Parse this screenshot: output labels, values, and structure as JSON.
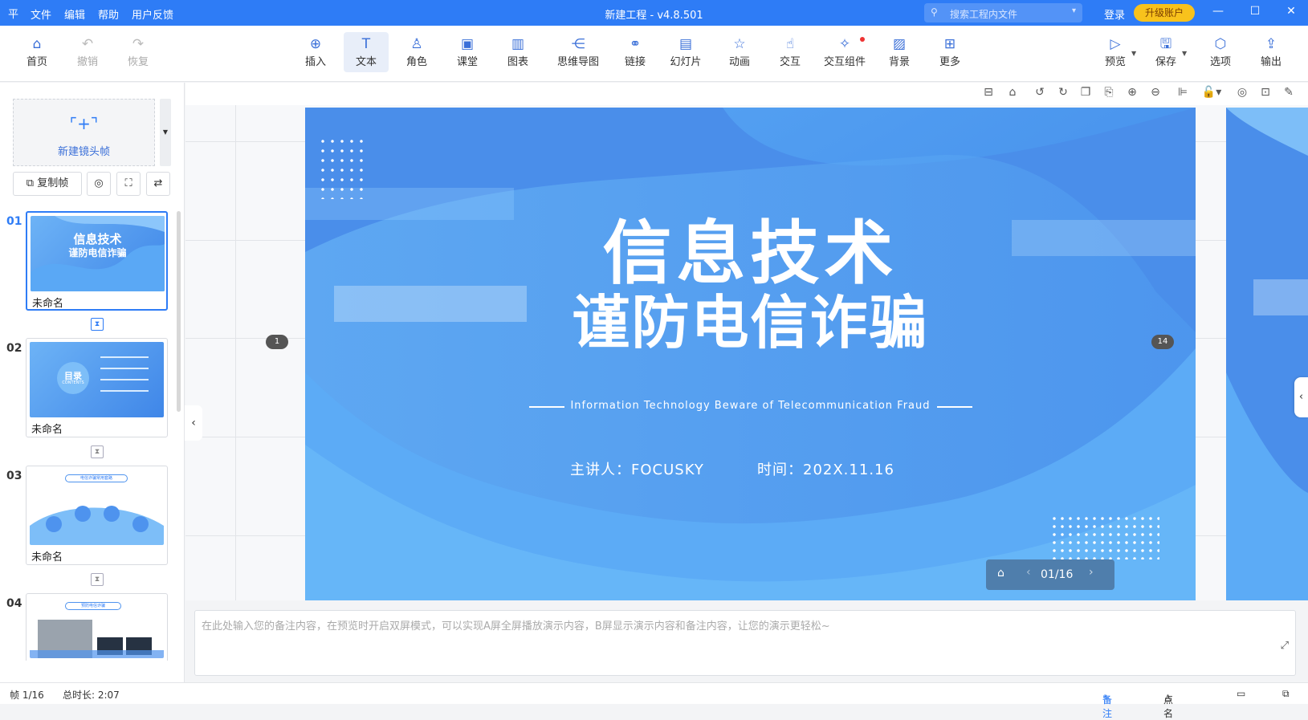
{
  "app": {
    "title": "新建工程 - v4.8.501",
    "logo_glyph": "平",
    "menu": [
      "文件",
      "编辑",
      "帮助",
      "用户反馈"
    ],
    "search_placeholder": "搜索工程内文件",
    "login": "登录",
    "upgrade": "升级账户"
  },
  "toolbar": {
    "left": [
      {
        "label": "首页",
        "icon": "home-icon"
      },
      {
        "label": "撤销",
        "icon": "undo-icon"
      },
      {
        "label": "恢复",
        "icon": "redo-icon"
      }
    ],
    "center": [
      {
        "label": "插入",
        "icon": "plus-circle-icon"
      },
      {
        "label": "文本",
        "icon": "text-icon"
      },
      {
        "label": "角色",
        "icon": "character-icon"
      },
      {
        "label": "课堂",
        "icon": "classroom-icon"
      },
      {
        "label": "图表",
        "icon": "chart-icon"
      },
      {
        "label": "思维导图",
        "icon": "mindmap-icon"
      },
      {
        "label": "链接",
        "icon": "link-icon"
      },
      {
        "label": "幻灯片",
        "icon": "slides-icon"
      },
      {
        "label": "动画",
        "icon": "star-icon"
      },
      {
        "label": "交互",
        "icon": "pointer-icon"
      },
      {
        "label": "交互组件",
        "icon": "interactive-component-icon"
      },
      {
        "label": "背景",
        "icon": "background-icon"
      },
      {
        "label": "更多",
        "icon": "more-grid-icon"
      }
    ],
    "right": [
      {
        "label": "预览",
        "icon": "preview-icon"
      },
      {
        "label": "保存",
        "icon": "save-icon"
      },
      {
        "label": "选项",
        "icon": "options-icon"
      },
      {
        "label": "输出",
        "icon": "export-icon"
      }
    ]
  },
  "left_panel": {
    "new_frame": "新建镜头帧",
    "copy_frame": "复制帧",
    "frames": [
      {
        "num": "01",
        "caption": "未命名",
        "thumb_title1": "信息技术",
        "thumb_title2": "谨防电信诈骗"
      },
      {
        "num": "02",
        "caption": "未命名",
        "thumb_title1": "目录",
        "thumb_title2": "CONTENTS"
      },
      {
        "num": "03",
        "caption": "未命名",
        "thumb_title1": "电信诈骗常用套路"
      },
      {
        "num": "04",
        "caption": "",
        "thumb_title1": "预防电信诈骗"
      }
    ]
  },
  "slide": {
    "title_line1": "信息技术",
    "title_line2": "谨防电信诈骗",
    "subtitle": "Information Technology Beware of Telecommunication Fraud",
    "presenter": "主讲人：FOCUSKY",
    "time": "时间：202X.11.16",
    "badge_left": "1",
    "badge_right": "14"
  },
  "pager": {
    "text": "01/16"
  },
  "notes": {
    "placeholder": "在此处输入您的备注内容，在预览时开启双屏模式，可以实现A屏全屏播放演示内容，B屏显示演示内容和备注内容，让您的演示更轻松~"
  },
  "status": {
    "frame": "帧 1/16",
    "duration": "总时长: 2:07",
    "notes_label": "备注",
    "rollcall_label": "点名"
  },
  "colors": {
    "accent": "#2e7cf6",
    "slide_blue": "#4e93ee",
    "upgrade": "#f8c21c"
  }
}
